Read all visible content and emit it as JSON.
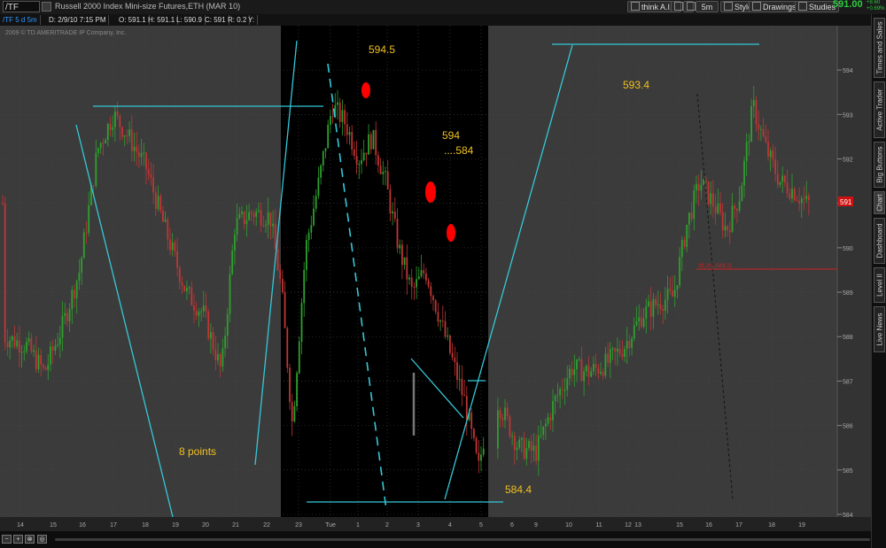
{
  "toolbar": {
    "symbol": "/TF",
    "title": "Russell 2000 Index Mini-size Futures,ETH (MAR 10)",
    "think_ai": "think A.I.",
    "interval": "5m",
    "style": "Style",
    "drawings": "Drawings",
    "studies": "Studies",
    "last_price": "591.00",
    "change_top": "+8.60",
    "change_bottom": "+0.69%"
  },
  "infobar": {
    "symbol_range": "/TF 5 d 5m",
    "date": "D: 2/9/10 7:15 PM",
    "open": "O: 591.1",
    "high": "H: 591.1",
    "low": "L: 590.9",
    "close": "C: 591",
    "range": "R: 0.2",
    "y": "Y:"
  },
  "copyright": "2009 © TD AMERITRADE IP Company, Inc.",
  "right_tabs": [
    "Times and Sales",
    "Active Trader",
    "Big Buttons",
    "Chart",
    "Dashboard",
    "Level II",
    "Live News"
  ],
  "annotations": {
    "a1": "594.5",
    "a2": "594",
    "a3": "....584",
    "a4": "593.4",
    "a5": "8  points",
    "a6": "584.4"
  },
  "price_marker": "591",
  "fib_label": "38.2%  (588.2)",
  "colors": {
    "background": "#3b3b3b",
    "highlight_session": "#000000",
    "up_candle": "#2ea02e",
    "down_candle": "#c03535",
    "trendline": "#34c8d8",
    "annotation": "#f0c020",
    "marker": "#ff0000"
  },
  "chart_data": {
    "type": "candlestick",
    "title": "Russell 2000 Index Mini-size Futures,ETH (MAR 10)",
    "ylim": [
      584,
      594.6
    ],
    "y_ticks": [
      584,
      585,
      586,
      587,
      588,
      589,
      590,
      591,
      592,
      593,
      594
    ],
    "x_tick_labels": [
      "14",
      "15",
      "16",
      "17",
      "18",
      "19",
      "20",
      "21",
      "22",
      "23",
      "Tue",
      "1",
      "2",
      "3",
      "4",
      "5",
      "6",
      "9",
      "10",
      "11",
      "12",
      "13",
      "15",
      "16",
      "17",
      "18",
      "19"
    ],
    "approx_close_path": [
      {
        "x": 5,
        "y": 588.0
      },
      {
        "x": 30,
        "y": 587.8
      },
      {
        "x": 50,
        "y": 587.2
      },
      {
        "x": 70,
        "y": 588.2
      },
      {
        "x": 90,
        "y": 589.5
      },
      {
        "x": 110,
        "y": 592.2
      },
      {
        "x": 128,
        "y": 593.0
      },
      {
        "x": 145,
        "y": 592.5
      },
      {
        "x": 165,
        "y": 591.8
      },
      {
        "x": 185,
        "y": 590.5
      },
      {
        "x": 210,
        "y": 589.0
      },
      {
        "x": 230,
        "y": 588.5
      },
      {
        "x": 250,
        "y": 587.2
      },
      {
        "x": 265,
        "y": 590.5
      },
      {
        "x": 285,
        "y": 590.8
      },
      {
        "x": 305,
        "y": 590.7
      },
      {
        "x": 318,
        "y": 589.0
      },
      {
        "x": 330,
        "y": 586.0
      },
      {
        "x": 345,
        "y": 590.0
      },
      {
        "x": 360,
        "y": 591.5
      },
      {
        "x": 375,
        "y": 593.2
      },
      {
        "x": 390,
        "y": 592.8
      },
      {
        "x": 405,
        "y": 592.0
      },
      {
        "x": 420,
        "y": 592.5
      },
      {
        "x": 435,
        "y": 591.5
      },
      {
        "x": 450,
        "y": 590.0
      },
      {
        "x": 465,
        "y": 589.0
      },
      {
        "x": 480,
        "y": 589.5
      },
      {
        "x": 495,
        "y": 588.5
      },
      {
        "x": 510,
        "y": 587.5
      },
      {
        "x": 525,
        "y": 586.5
      },
      {
        "x": 540,
        "y": 585.0
      },
      {
        "x": 555,
        "y": 586.8
      },
      {
        "x": 570,
        "y": 586.2
      },
      {
        "x": 585,
        "y": 585.5
      },
      {
        "x": 605,
        "y": 585.4
      },
      {
        "x": 625,
        "y": 586.5
      },
      {
        "x": 645,
        "y": 587.3
      },
      {
        "x": 665,
        "y": 587.2
      },
      {
        "x": 685,
        "y": 587.4
      },
      {
        "x": 705,
        "y": 587.8
      },
      {
        "x": 725,
        "y": 588.5
      },
      {
        "x": 745,
        "y": 588.8
      },
      {
        "x": 760,
        "y": 588.9
      },
      {
        "x": 775,
        "y": 590.5
      },
      {
        "x": 790,
        "y": 591.5
      },
      {
        "x": 805,
        "y": 591.0
      },
      {
        "x": 820,
        "y": 590.4
      },
      {
        "x": 835,
        "y": 591.2
      },
      {
        "x": 850,
        "y": 593.2
      },
      {
        "x": 865,
        "y": 592.2
      },
      {
        "x": 880,
        "y": 591.5
      },
      {
        "x": 895,
        "y": 591.3
      },
      {
        "x": 910,
        "y": 591.0
      }
    ]
  }
}
